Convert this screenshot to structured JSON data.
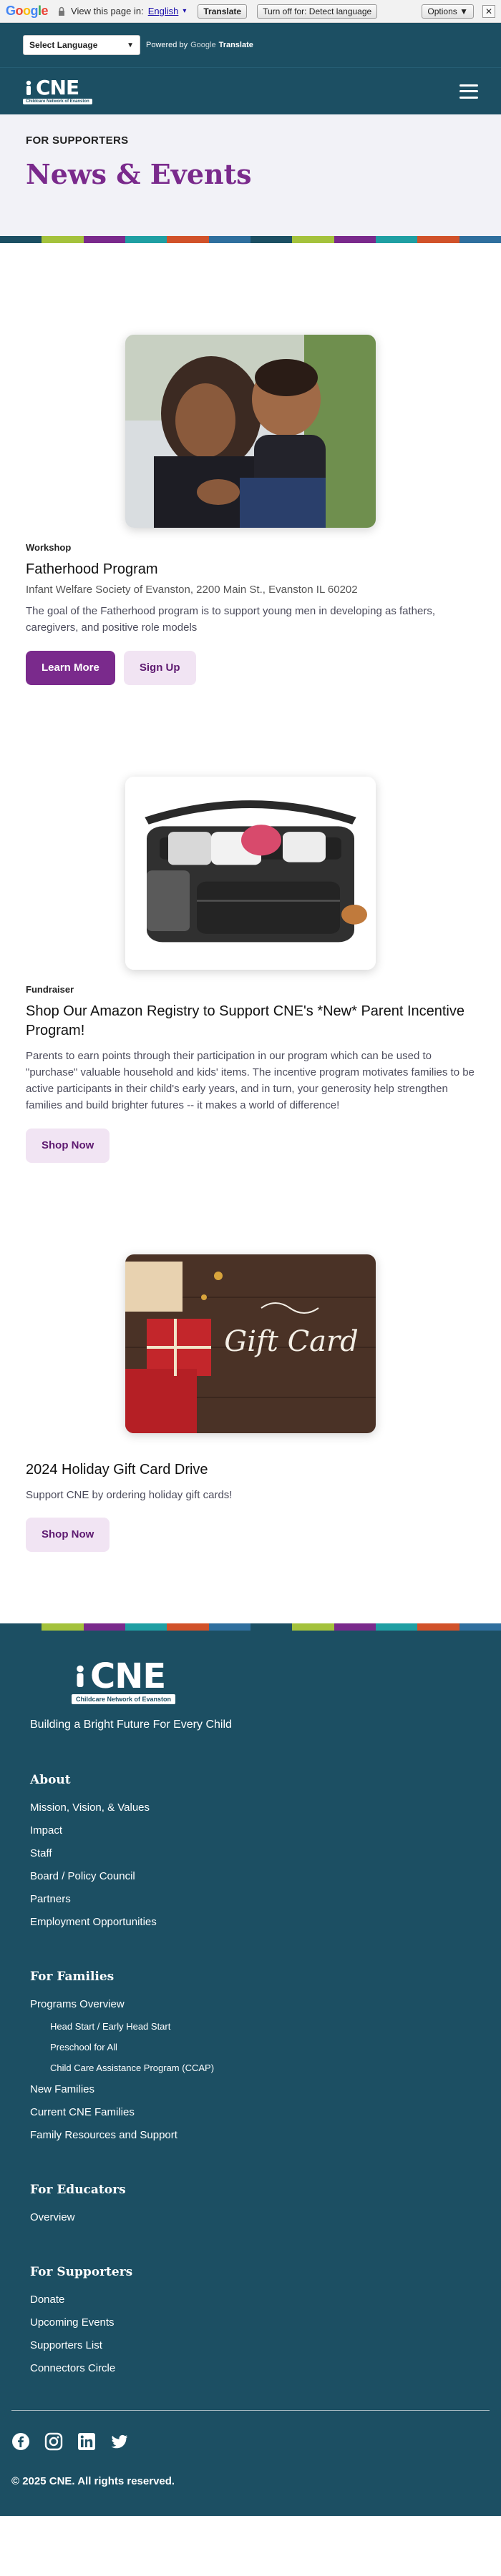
{
  "translate_bar": {
    "logo_letters": [
      "G",
      "o",
      "o",
      "g",
      "l",
      "e"
    ],
    "view_text": "View this page in:",
    "language": "English",
    "translate_btn": "Translate",
    "turn_off_btn": "Turn off for: Detect language",
    "options_btn": "Options ▼",
    "close": "✕"
  },
  "lang_strip": {
    "select_value": "Select Language",
    "powered_by": "Powered by",
    "google": "Google",
    "translate": "Translate"
  },
  "header": {
    "logo_text": "CNE",
    "logo_sub": "Childcare Network of Evanston"
  },
  "hero": {
    "eyebrow": "FOR SUPPORTERS",
    "title": "News & Events"
  },
  "stripe_colors": [
    "#1c4f63",
    "#a4c23c",
    "#7a2a8c",
    "#1f9fa3",
    "#d1522a",
    "#2f6f9e"
  ],
  "events": [
    {
      "type": "Workshop",
      "title": "Fatherhood Program",
      "location": "Infant Welfare Society of Evanston, 2200 Main St., Evanston IL 60202",
      "description": "The goal of the Fatherhood program is to support young men in developing as fathers, caregivers, and positive role models",
      "buttons": [
        "Learn More",
        "Sign Up"
      ]
    },
    {
      "type": "Fundraiser",
      "title": "Shop Our Amazon Registry to Support CNE's *New* Parent Incentive Program!",
      "description": "Parents to earn points through their participation in our program which can be used to \"purchase\" valuable household and kids' items. The incentive program motivates families to be active participants in their child's early years, and in turn, your generosity help strengthen families and build brighter futures -- it makes a world of difference!",
      "buttons": [
        "Shop Now"
      ]
    },
    {
      "title": "2024 Holiday Gift Card Drive",
      "description": "Support CNE by ordering holiday gift cards!",
      "image_text": "Gift Card",
      "buttons": [
        "Shop Now"
      ]
    }
  ],
  "footer": {
    "logo_text": "CNE",
    "logo_sub": "Childcare Network of Evanston",
    "tagline": "Building a Bright Future For Every Child",
    "sections": {
      "about": {
        "heading": "About",
        "links": [
          "Mission, Vision, & Values",
          "Impact",
          "Staff",
          "Board / Policy Council",
          "Partners",
          "Employment Opportunities"
        ]
      },
      "families": {
        "heading": "For Families",
        "programs": "Programs Overview",
        "sub_links": [
          "Head Start / Early Head Start",
          "Preschool for All",
          "Child Care Assistance Program (CCAP)"
        ],
        "links": [
          "New Families",
          "Current CNE Families",
          "Family Resources and Support"
        ]
      },
      "educators": {
        "heading": "For Educators",
        "links": [
          "Overview"
        ]
      },
      "supporters": {
        "heading": "For Supporters",
        "links": [
          "Donate",
          "Upcoming Events",
          "Supporters List",
          "Connectors Circle"
        ]
      }
    },
    "socials": [
      "facebook-icon",
      "instagram-icon",
      "linkedin-icon",
      "twitter-icon"
    ],
    "copyright": "© 2025 CNE. All rights reserved."
  }
}
